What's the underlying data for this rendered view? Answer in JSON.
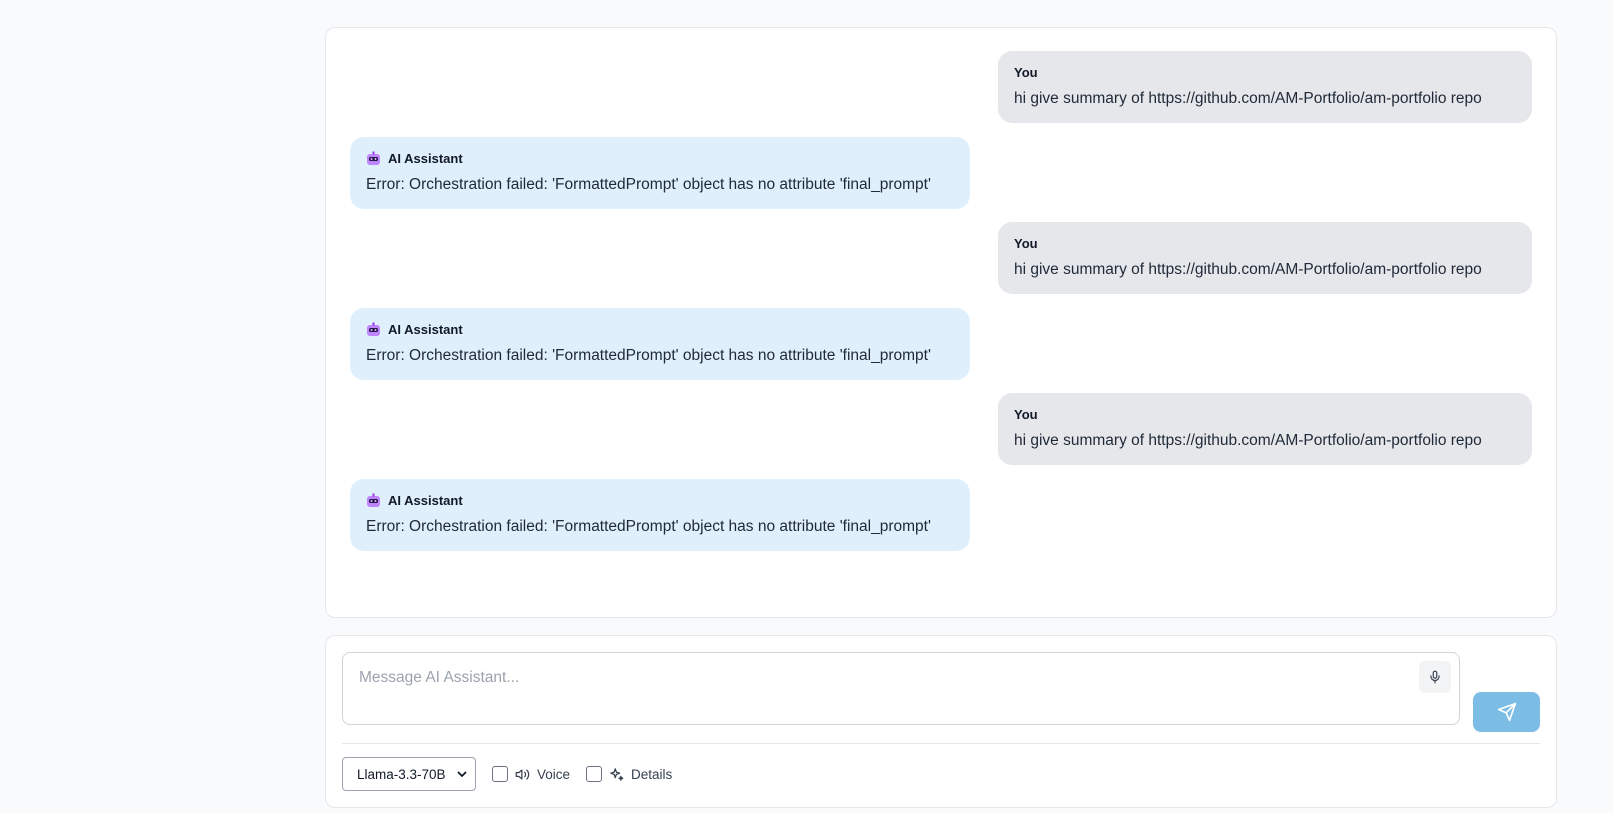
{
  "messages": [
    {
      "role": "user",
      "sender": "You",
      "text": "hi give summary of https://github.com/AM-Portfolio/am-portfolio repo"
    },
    {
      "role": "ai",
      "sender": "AI Assistant",
      "text": "Error: Orchestration failed: 'FormattedPrompt' object has no attribute 'final_prompt'"
    },
    {
      "role": "user",
      "sender": "You",
      "text": "hi give summary of https://github.com/AM-Portfolio/am-portfolio repo"
    },
    {
      "role": "ai",
      "sender": "AI Assistant",
      "text": "Error: Orchestration failed: 'FormattedPrompt' object has no attribute 'final_prompt'"
    },
    {
      "role": "user",
      "sender": "You",
      "text": "hi give summary of https://github.com/AM-Portfolio/am-portfolio repo"
    },
    {
      "role": "ai",
      "sender": "AI Assistant",
      "text": "Error: Orchestration failed: 'FormattedPrompt' object has no attribute 'final_prompt'"
    }
  ],
  "composer": {
    "placeholder": "Message AI Assistant...",
    "value": "",
    "model_selected": "Llama-3.3-70B",
    "voice_label": "Voice",
    "voice_checked": false,
    "details_label": "Details",
    "details_checked": false
  },
  "icons": {
    "assistant": "robot-icon",
    "mic": "microphone-icon",
    "send": "send-icon",
    "voice": "speaker-icon",
    "details": "sparkles-icon",
    "select": "chevron-down-icon"
  },
  "colors": {
    "page_bg": "#f8fafc",
    "user_bubble": "#e5e7eb",
    "ai_bubble": "#dff0fc",
    "send_button": "#7cbde6"
  }
}
